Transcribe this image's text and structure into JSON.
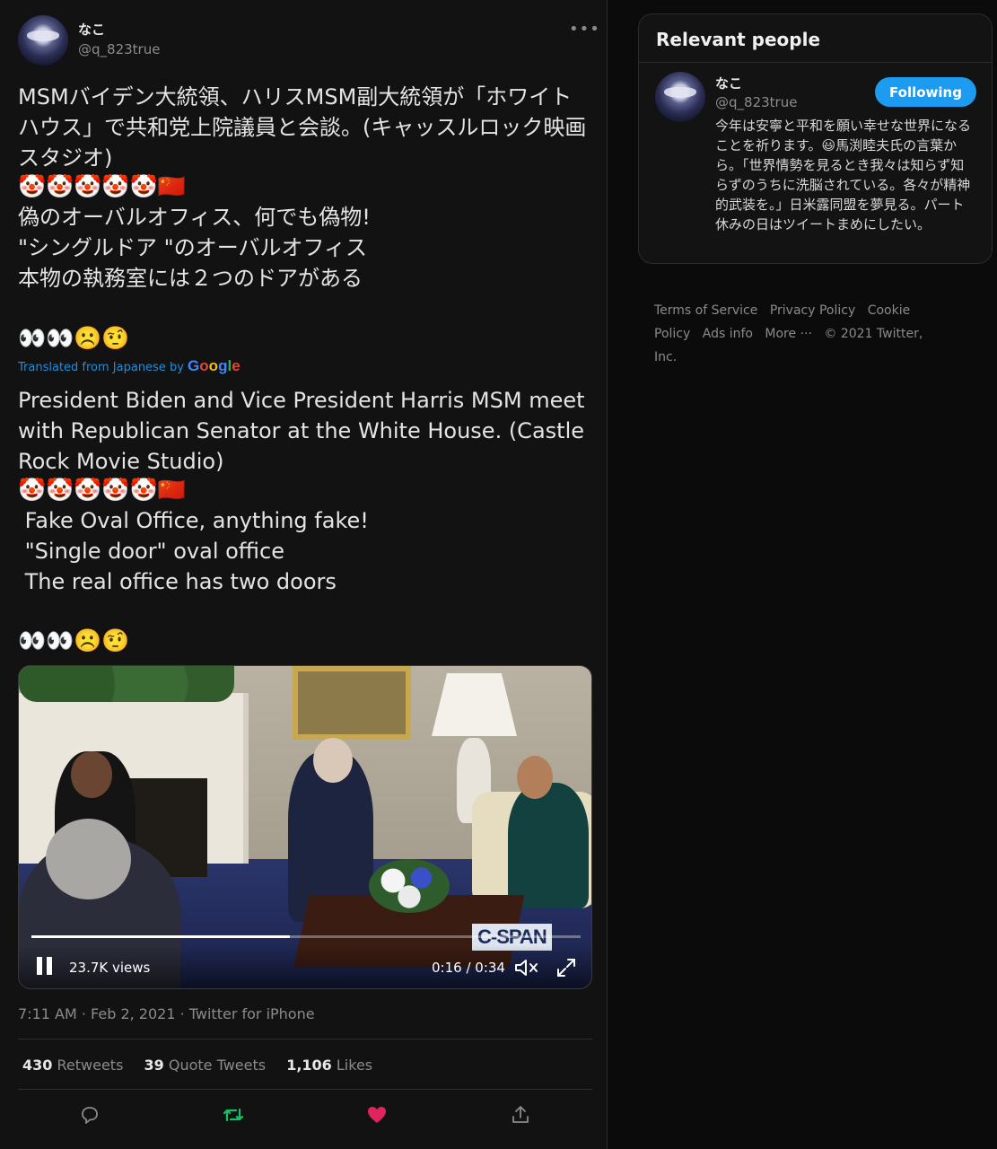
{
  "tweet": {
    "author_name": "なこ",
    "author_handle": "@q_823true",
    "more_label": "•••",
    "text_ja": "MSMバイデン大統領、ハリスMSM副大統領が「ホワイトハウス」で共和党上院議員と会談。(キャッスルロック映画スタジオ)",
    "emoji_row_1": "🤡🤡🤡🤡🤡🇨🇳",
    "text_ja_2": "偽のオーバルオフィス、何でも偽物!\n\"シングルドア \"のオーバルオフィス\n本物の執務室には２つのドアがある",
    "emoji_row_2": "👀👀☹️🤨",
    "translated_label": "Translated from Japanese by",
    "translator": {
      "g1": "G",
      "o1": "o",
      "o2": "o",
      "g2": "g",
      "l": "l",
      "e": "e"
    },
    "text_en": "President Biden and Vice President Harris MSM meet with Republican Senator at the White House. (Castle Rock Movie Studio)",
    "emoji_row_3": "🤡🤡🤡🤡🤡🇨🇳",
    "text_en_2": " Fake Oval Office, anything fake!\n \"Single door\" oval office\n The real office has two doors",
    "emoji_row_4": "👀👀☹️🤨",
    "video": {
      "watermark": "C-SPAN",
      "views": "23.7K views",
      "time": "0:16 / 0:34",
      "progress": 0.47
    },
    "meta": "7:11 AM · Feb 2, 2021 · Twitter for iPhone",
    "stats": {
      "retweets_count": "430",
      "retweets_label": "Retweets",
      "quotes_count": "39",
      "quotes_label": "Quote Tweets",
      "likes_count": "1,106",
      "likes_label": "Likes"
    },
    "actions": [
      "reply-icon",
      "retweet-icon",
      "like-icon",
      "share-icon"
    ],
    "colors": {
      "retweet": "#17bf63",
      "like": "#e0245e",
      "link": "#1d9bf0"
    }
  },
  "relevant_people": {
    "title": "Relevant people",
    "name": "なこ",
    "handle": "@q_823true",
    "follow_label": "Following",
    "bio": "今年は安寧と平和を願い幸せな世界になることを祈ります。😃馬渕睦夫氏の言葉から。「世界情勢を見るとき我々は知らず知らずのうちに洗脳されている。各々が精神的武装を。」日米露同盟を夢見る。パート休みの日はツイートまめにしたい。"
  },
  "footer": {
    "links": [
      "Terms of Service",
      "Privacy Policy",
      "Cookie Policy",
      "Ads info",
      "More ···"
    ],
    "copyright": "© 2021 Twitter, Inc."
  }
}
